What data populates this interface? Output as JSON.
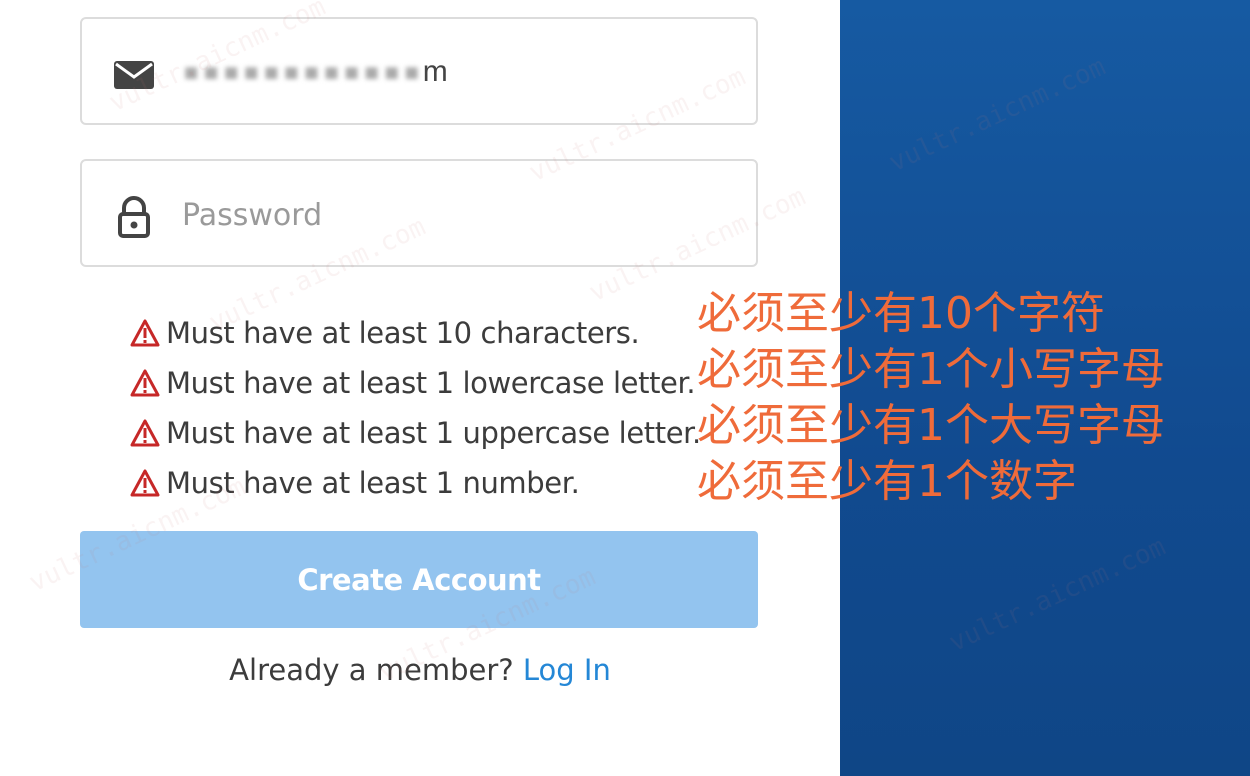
{
  "signup": {
    "email_value": "m",
    "password_placeholder": "Password",
    "requirements": [
      "Must have at least 10 characters.",
      "Must have at least 1 lowercase letter.",
      "Must have at least 1 uppercase letter.",
      "Must have at least 1 number."
    ],
    "create_button_label": "Create Account",
    "member_text": "Already a member?",
    "login_link": "Log In"
  },
  "annotations": [
    "必须至少有10个字符",
    "必须至少有1个小写字母",
    "必须至少有1个大写字母",
    "必须至少有1个数字"
  ],
  "watermark": "vultr.aicnm.com",
  "colors": {
    "button": "#93c4ef",
    "link": "#2487d6",
    "annotation": "#ef6b3a",
    "side_panel": "#165aa2",
    "warning": "#c62828"
  },
  "icons": {
    "email": "envelope-icon",
    "password": "lock-icon",
    "requirement": "warning-icon"
  }
}
